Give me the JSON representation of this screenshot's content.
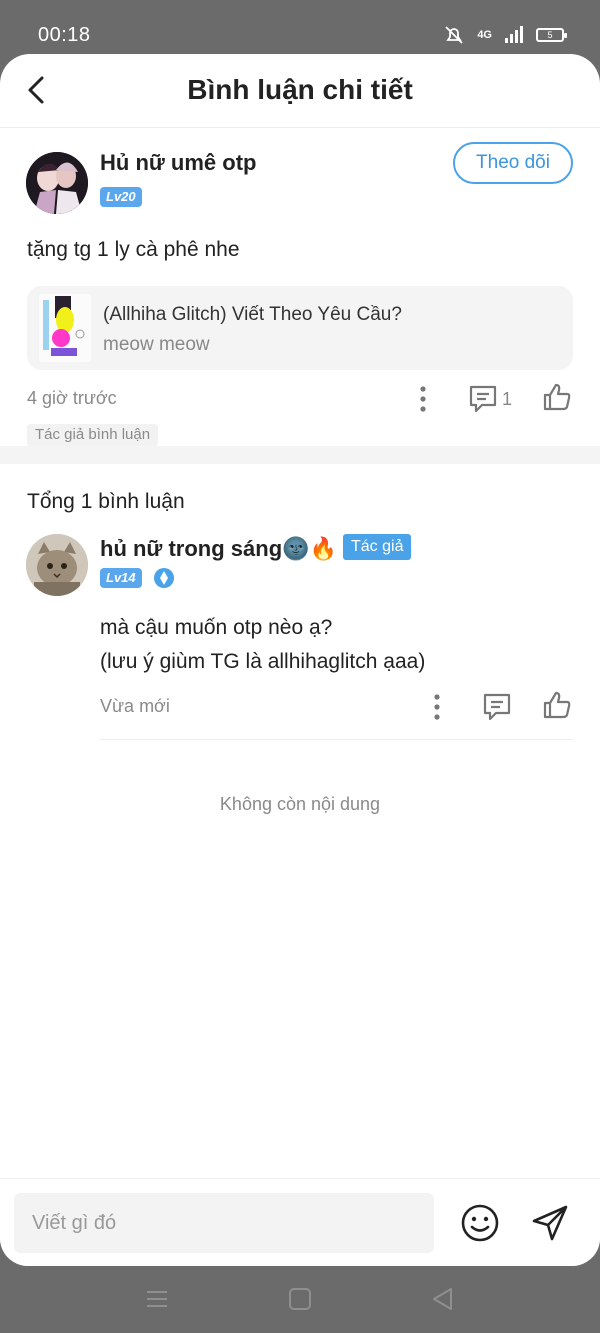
{
  "status_bar": {
    "time": "00:18",
    "signal_label": "4G",
    "battery": "5"
  },
  "header": {
    "title": "Bình luận chi tiết"
  },
  "post": {
    "user_name": "Hủ nữ umê otp",
    "level": "Lv20",
    "follow_label": "Theo dõi",
    "text": "tặng tg 1 ly cà phê nhe",
    "story": {
      "title": "(Allhiha Glitch) Viết Theo Yêu Cầu?",
      "author": "meow meow"
    },
    "time": "4 giờ trước",
    "reply_count": "1",
    "author_tag": "Tác giả bình luận"
  },
  "comments": {
    "total_label": "Tổng 1 bình luận",
    "items": [
      {
        "user_name": "hủ nữ trong sáng🌚🔥",
        "author_chip": "Tác giả",
        "level": "Lv14",
        "lines": [
          "mà cậu muốn otp nèo ạ?",
          "(lưu ý giùm TG là allhihaglitch ạaa)"
        ],
        "time": "Vừa mới"
      }
    ],
    "end_label": "Không còn nội dung"
  },
  "input": {
    "placeholder": "Viết gì đó"
  },
  "colors": {
    "accent": "#4aa3e8",
    "level_badge": "#5aa7ee",
    "muted": "#8a8a8a"
  },
  "icons": [
    "back-arrow-icon",
    "more-icon",
    "comment-icon",
    "like-icon",
    "emoji-icon",
    "send-icon",
    "shield-icon",
    "menu-icon",
    "home-icon",
    "back-icon"
  ]
}
